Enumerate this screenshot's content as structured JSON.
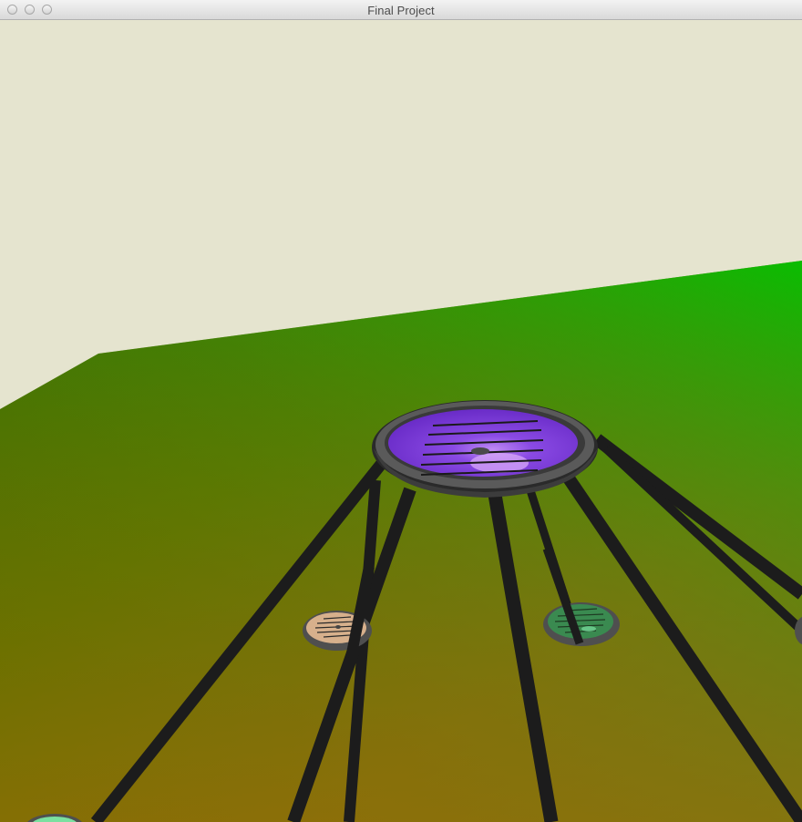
{
  "window": {
    "title": "Final Project",
    "buttons": [
      {
        "name": "close-button",
        "label": "close"
      },
      {
        "name": "minimize-button",
        "label": "minimize"
      },
      {
        "name": "zoom-button",
        "label": "zoom"
      }
    ]
  },
  "scene": {
    "background_color": "#e5e4cf",
    "ground_colors": [
      "#2c7a00",
      "#00c000",
      "#8a6c00",
      "#6f8c3a"
    ],
    "pole_color": "#1c1c1c",
    "rim_color": "#505050",
    "platforms": [
      {
        "name": "platform-purple",
        "color": "#7b3fd8"
      },
      {
        "name": "platform-tan",
        "color": "#d7b08c"
      },
      {
        "name": "platform-green",
        "color": "#3a8a50"
      },
      {
        "name": "platform-light-green",
        "color": "#7be0a0"
      }
    ]
  }
}
